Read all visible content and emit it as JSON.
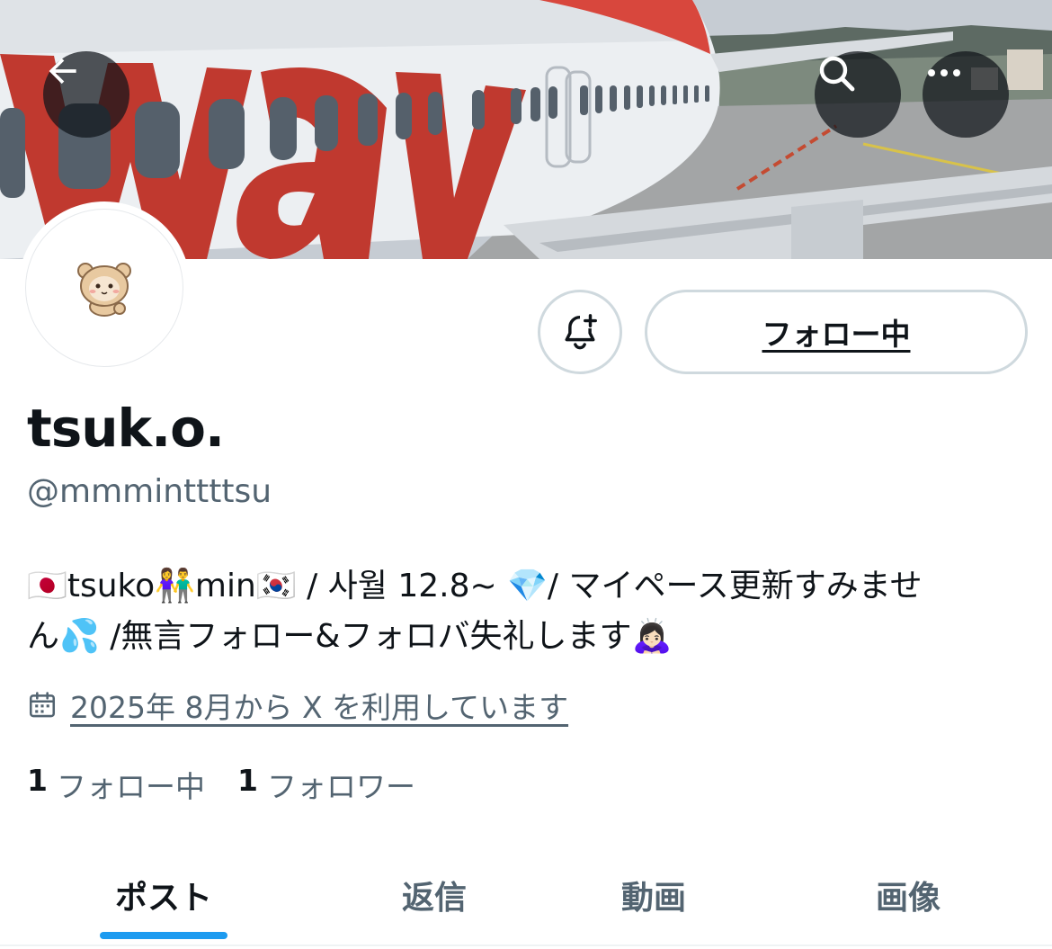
{
  "header": {
    "back_icon": "arrow-left-icon",
    "search_icon": "search-icon",
    "more_icon": "ellipsis-icon",
    "banner_text": "way"
  },
  "profile": {
    "display_name": "tsuk.o.",
    "handle": "@mmminttttsu",
    "bio_line1": "🇯🇵tsuko👫min🇰🇷 / 사월 12.8~ 💎/ マイペース更新すみませ",
    "bio_line2": "ん💦 /無言フォロー&フォロバ失礼します🙇🏻‍♀️",
    "joined": "2025年 8月から X を利用しています",
    "avatar_icon": "bear-avatar-icon"
  },
  "actions": {
    "notify_icon": "bell-plus-icon",
    "follow_label": "フォロー中"
  },
  "stats": {
    "following_count": "1",
    "following_label": "フォロー中",
    "followers_count": "1",
    "followers_label": "フォロワー"
  },
  "tabs": [
    {
      "label": "ポスト",
      "active": true
    },
    {
      "label": "返信",
      "active": false
    },
    {
      "label": "動画",
      "active": false
    },
    {
      "label": "画像",
      "active": false
    }
  ],
  "colors": {
    "accent": "#1d9bf0",
    "secondary_text": "#536471",
    "border": "#cfd9de",
    "banner_red": "#c0392f"
  }
}
